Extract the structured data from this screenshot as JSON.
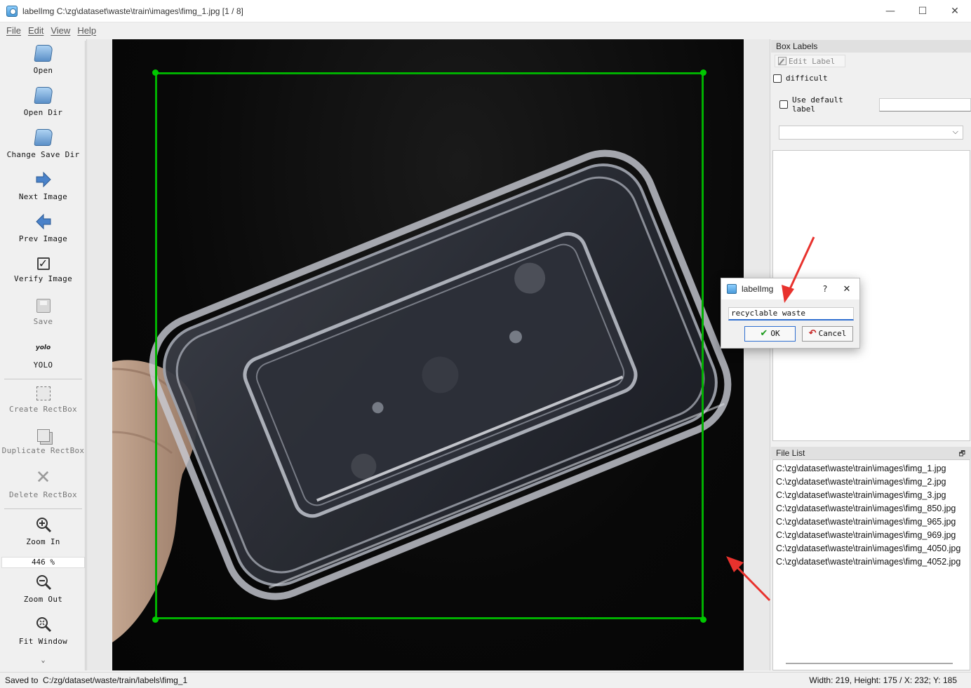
{
  "window": {
    "title": "labelImg C:\\zg\\dataset\\waste\\train\\images\\fimg_1.jpg [1 / 8]",
    "minimize": "—",
    "maximize": "☐",
    "close": "✕"
  },
  "menu": [
    "File",
    "Edit",
    "View",
    "Help"
  ],
  "toolbar": {
    "open": "Open",
    "open_dir": "Open Dir",
    "change_save_dir": "Change Save Dir",
    "next_image": "Next Image",
    "prev_image": "Prev Image",
    "verify_image": "Verify Image",
    "save": "Save",
    "format_icon": "yolo",
    "format": "YOLO",
    "create_rectbox": "Create RectBox",
    "duplicate_rectbox": "Duplicate RectBox",
    "delete_rectbox": "Delete RectBox",
    "zoom_in": "Zoom In",
    "zoom_level": "446 %",
    "zoom_out": "Zoom Out",
    "fit_window": "Fit Window",
    "more": "⌄"
  },
  "box_labels": {
    "title": "Box Labels",
    "float_icon": "🗗",
    "edit_label": "Edit Label",
    "difficult": "difficult",
    "use_default_label": "Use default label",
    "default_label_value": "",
    "combo_value": ""
  },
  "file_list": {
    "title": "File List",
    "float_icon": "🗗",
    "items": [
      "C:\\zg\\dataset\\waste\\train\\images\\fimg_1.jpg",
      "C:\\zg\\dataset\\waste\\train\\images\\fimg_2.jpg",
      "C:\\zg\\dataset\\waste\\train\\images\\fimg_3.jpg",
      "C:\\zg\\dataset\\waste\\train\\images\\fimg_850.jpg",
      "C:\\zg\\dataset\\waste\\train\\images\\fimg_965.jpg",
      "C:\\zg\\dataset\\waste\\train\\images\\fimg_969.jpg",
      "C:\\zg\\dataset\\waste\\train\\images\\fimg_4050.jpg",
      "C:\\zg\\dataset\\waste\\train\\images\\fimg_4052.jpg"
    ]
  },
  "dialog": {
    "title": "labelImg",
    "help": "?",
    "close": "✕",
    "input_value": "recyclable waste",
    "ok": "OK",
    "cancel": "Cancel"
  },
  "status": {
    "left": "Saved to  C:/zg/dataset/waste/train/labels\\fimg_1",
    "right": "Width: 219, Height: 175 / X: 232; Y: 185"
  },
  "colors": {
    "bbox": "#00b000",
    "annotation_arrow": "#e8322d",
    "accent": "#2f6fd0"
  }
}
